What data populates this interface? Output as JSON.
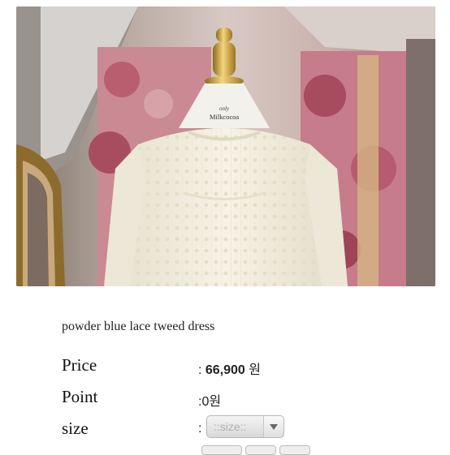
{
  "product": {
    "name": "powder blue lace tweed dress",
    "image": {
      "mannequin_label": "only Milkcocoa"
    }
  },
  "details": {
    "price": {
      "label": "Price",
      "prefix": ": ",
      "amount": "66,900",
      "currency": "원"
    },
    "point": {
      "label": "Point",
      "value": ":0원"
    },
    "size": {
      "label": "size",
      "prefix": ":",
      "placeholder": "::size::"
    }
  },
  "colors": {
    "background": "#ffffff",
    "text": "#222222",
    "select_bg": "#e6e6e6"
  }
}
